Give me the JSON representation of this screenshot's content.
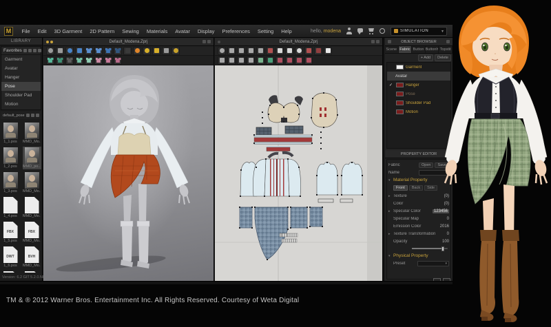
{
  "window": {
    "logo": "M",
    "menus": [
      "File",
      "Edit",
      "3D Garment",
      "2D Pattern",
      "Sewing",
      "Materials",
      "Avatar",
      "Display",
      "Preferences",
      "Setting",
      "Help"
    ],
    "greeting": "hello,",
    "username": "modena",
    "icons": [
      {
        "name": "account-icon"
      },
      {
        "name": "chat-icon"
      },
      {
        "name": "cart-icon"
      },
      {
        "name": "settings-gear-icon"
      }
    ],
    "mode_dropdown": {
      "label": "SIMULATION"
    }
  },
  "library": {
    "tab_label": "LIBRARY",
    "favorites": {
      "title": "Favorites",
      "icons": [
        {
          "name": "add-favorite-icon"
        },
        {
          "name": "thumbnail-view-icon"
        },
        {
          "name": "list-view-icon"
        },
        {
          "name": "refresh-icon"
        }
      ],
      "items": [
        "Garment",
        "Avatar",
        "Hanger",
        "Pose",
        "Shoulder Pad",
        "Motion"
      ],
      "selected": "Pose"
    },
    "folder": {
      "label": "default_pose",
      "icons": [
        {
          "name": "back-folder-icon"
        },
        {
          "name": "open-folder-icon"
        },
        {
          "name": "refresh-folder-icon"
        }
      ]
    },
    "thumbnails": [
      {
        "type": "portrait",
        "label": "1_1.pos"
      },
      {
        "type": "portrait",
        "label": "MMD_Mo..."
      },
      {
        "type": "portrait",
        "label": "1_2.pos"
      },
      {
        "type": "portrait",
        "label": "MMD_po...",
        "selected": true
      },
      {
        "type": "portrait",
        "label": "1_3.pos"
      },
      {
        "type": "portrait",
        "label": "MMD_Mo..."
      },
      {
        "type": "page",
        "label": "1_4.pos"
      },
      {
        "type": "page",
        "label": "MMD_Mo..."
      },
      {
        "type": "page",
        "label": "1_5.pos",
        "badge": "FBX"
      },
      {
        "type": "page",
        "label": "MMD_Mo...",
        "badge": "FBX"
      },
      {
        "type": "page",
        "label": "1_6.pos",
        "badge": "DWT"
      },
      {
        "type": "page",
        "label": "MMD_Mo...",
        "badge": "BVH"
      },
      {
        "type": "page",
        "label": ""
      },
      {
        "type": "page",
        "label": ""
      }
    ],
    "version": "Version: 6.2 GIT 5.2.0.NB"
  },
  "viewport3d": {
    "title": "Default_Modena.Zprj",
    "tools_row1": [
      {
        "name": "pan-hand-icon",
        "color": "#9a9a9a",
        "shape": "circle"
      },
      {
        "name": "select-move-icon",
        "color": "#9a9a9a",
        "shape": "square"
      },
      {
        "name": "simulate-icon",
        "color": "#4a84c8",
        "shape": "circle"
      },
      {
        "name": "select-mesh-icon",
        "color": "#4a84c8",
        "shape": "square"
      },
      {
        "name": "move-garment-icon",
        "color": "#5b8fd0",
        "shape": "shirt"
      },
      {
        "name": "fold-garment-icon",
        "color": "#5b8fd0",
        "shape": "shirt"
      },
      {
        "name": "refit-garment-icon",
        "color": "#3f74b4",
        "shape": "shirt"
      },
      {
        "name": "wind-icon",
        "color": "#33567e",
        "shape": "shirt"
      },
      {
        "name": "grid-window-icon",
        "color": "#3a3a3a",
        "shape": "square"
      },
      {
        "name": "avatar-display-icon",
        "color": "#e0862a",
        "shape": "circle"
      },
      {
        "name": "gizmo-sphere-icon",
        "color": "#d8b02a",
        "shape": "circle"
      },
      {
        "name": "pin-avatar-icon",
        "color": "#d8b02a",
        "shape": "square"
      },
      {
        "name": "reset-pose-icon",
        "color": "#9a9a9a",
        "shape": "square"
      },
      {
        "name": "tack-pin-icon",
        "color": "#c8a22a",
        "shape": "circle"
      }
    ],
    "tools_row2": [
      {
        "name": "show-garment-icon",
        "color": "#58b89a",
        "shape": "shirt"
      },
      {
        "name": "show-seams-icon",
        "color": "#3f8f74",
        "shape": "shirt"
      },
      {
        "name": "show-internal-icon",
        "color": "#5a5a5a",
        "shape": "shirt"
      },
      {
        "name": "mesh-garment-icon",
        "color": "#74c0a4",
        "shape": "shirt"
      },
      {
        "name": "texture-garment-icon",
        "color": "#8fccb2",
        "shape": "shirt"
      },
      {
        "name": "thick-texture-icon",
        "color": "#cc8aa4",
        "shape": "shirt"
      },
      {
        "name": "thick-surface-icon",
        "color": "#c87a9a",
        "shape": "shirt"
      },
      {
        "name": "stress-map-icon",
        "color": "#b86a8a",
        "shape": "shirt"
      }
    ]
  },
  "pattern2d": {
    "title": "Default_Modena.Zprj",
    "tools_row1": [
      {
        "name": "transform-pattern-icon",
        "color": "#a8a8a8",
        "shape": "circle"
      },
      {
        "name": "edit-pattern-icon",
        "color": "#a8a8a8",
        "shape": "square"
      },
      {
        "name": "edit-point-icon",
        "color": "#a8a8a8",
        "shape": "square"
      },
      {
        "name": "add-point-icon",
        "color": "#a8a8a8",
        "shape": "square"
      },
      {
        "name": "edit-curve-icon",
        "color": "#a8a8a8",
        "shape": "square"
      },
      {
        "name": "add-curve-point-icon",
        "color": "#b05050",
        "shape": "square"
      },
      {
        "name": "polygon-tool-icon",
        "color": "#d8d8d8",
        "shape": "square"
      },
      {
        "name": "rectangle-tool-icon",
        "color": "#d8d8d8",
        "shape": "square"
      },
      {
        "name": "circle-tool-icon",
        "color": "#d8d8d8",
        "shape": "circle"
      },
      {
        "name": "dart-tool-icon",
        "color": "#b05050",
        "shape": "square"
      },
      {
        "name": "rect-dart-icon",
        "color": "#904040",
        "shape": "square"
      },
      {
        "name": "specification-icon",
        "color": "#e8e8e8",
        "shape": "square"
      }
    ],
    "tools_row2": [
      {
        "name": "edit-texture-icon",
        "color": "#a8a8a8",
        "shape": "square"
      },
      {
        "name": "pattern-copy-icon",
        "color": "#a8a8a8",
        "shape": "square"
      },
      {
        "name": "pattern-mirror-icon",
        "color": "#a8a8a8",
        "shape": "square"
      },
      {
        "name": "pattern-flip-icon",
        "color": "#a8a8a8",
        "shape": "square"
      },
      {
        "name": "segment-sewing-icon",
        "color": "#79b48e",
        "shape": "square"
      },
      {
        "name": "free-sewing-icon",
        "color": "#4aa07a",
        "shape": "square"
      },
      {
        "name": "m-n-sewing-icon",
        "color": "#b05060",
        "shape": "square"
      },
      {
        "name": "edit-sewing-icon",
        "color": "#b05060",
        "shape": "square"
      },
      {
        "name": "sewing-direction-icon",
        "color": "#b05060",
        "shape": "square"
      },
      {
        "name": "detach-sewing-icon",
        "color": "#b05060",
        "shape": "square"
      }
    ]
  },
  "object_browser": {
    "title": "OBJECT BROWSER",
    "tabs": [
      "Scene",
      "Fabric",
      "Button",
      "Buttonh",
      "Topstit"
    ],
    "active_tab": "Fabric",
    "actions": [
      {
        "name": "add-object-button",
        "label": "+ Add"
      },
      {
        "name": "delete-object-button",
        "label": "Delete"
      }
    ],
    "rows": [
      {
        "type": "item",
        "label": "Garment",
        "swatch": "#f5f5f5",
        "checked": false
      },
      {
        "type": "group",
        "label": "Avatar"
      },
      {
        "type": "item",
        "label": "Hanger",
        "swatch": "#7a1d1d",
        "checked": true
      },
      {
        "type": "item",
        "label": "Pose",
        "swatch": "#7a1d1d",
        "checked": false,
        "dim": true
      },
      {
        "type": "item",
        "label": "Shoulder Pad",
        "swatch": "#7a1d1d",
        "checked": false
      },
      {
        "type": "item",
        "label": "Motion",
        "swatch": "#7a1d1d",
        "checked": false
      }
    ]
  },
  "property_editor": {
    "title": "PROPERTY EDITOR",
    "fabric_row": {
      "label": "Fabric",
      "buttons": [
        {
          "name": "open-fabric-button",
          "label": "Open"
        },
        {
          "name": "save-fabric-button",
          "label": "Save"
        }
      ]
    },
    "name_row": {
      "label": "Name",
      "value": ""
    },
    "material_property": {
      "label": "Material Property",
      "tabs": [
        "Front",
        "Back",
        "Side"
      ],
      "active_tab": "Front",
      "rows": [
        {
          "label": "Texture",
          "value": "(0)",
          "arrow": true
        },
        {
          "label": "Color",
          "value": "(0)",
          "arrow": false
        },
        {
          "label": "Specular Color",
          "value": "123456",
          "arrow": true,
          "highlight": true
        },
        {
          "label": "Specular Map",
          "value": "0",
          "arrow": false
        },
        {
          "label": "Emission Color",
          "value": "2016",
          "arrow": false
        },
        {
          "label": "Texture Transformation",
          "value": "0",
          "arrow": true
        }
      ],
      "opacity": {
        "label": "Opacity",
        "value": "100"
      }
    },
    "physical_property": {
      "label": "Physical Property",
      "preset": {
        "label": "Preset",
        "value": ""
      }
    }
  },
  "footer": {
    "copyright": "TM & ® 2012 Warner Bros. Entertainment Inc. All Rights Reserved. Courtesy of Weta Digital"
  },
  "colors": {
    "accent_yellow": "#c8a23c",
    "swatch_red": "#7a1d1d",
    "hair_orange": "#f08a28",
    "skirt_rust": "#b2491d",
    "plaid_green": "#90a47e",
    "pattern_red": "#a23a3a",
    "pattern_blue": "#dceaf0",
    "plaid_blue": "#7e94a9"
  }
}
